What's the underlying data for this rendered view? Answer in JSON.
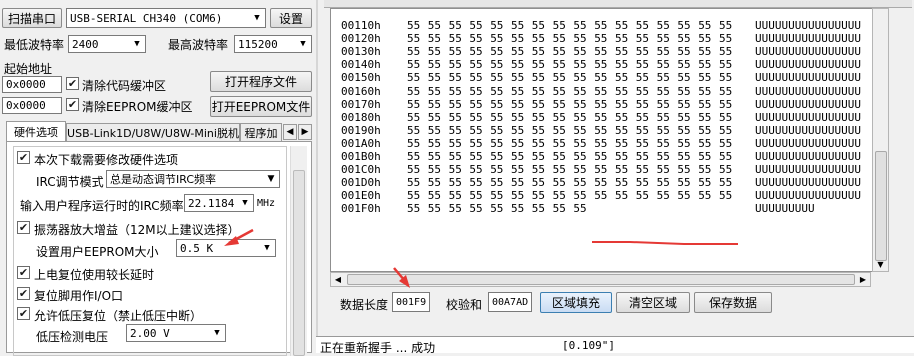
{
  "left": {
    "scan_button": "扫描串口",
    "port_value": "USB-SERIAL CH340 (COM6)",
    "settings_button": "设置",
    "min_baud_label": "最低波特率",
    "min_baud_value": "2400",
    "max_baud_label": "最高波特率",
    "max_baud_value": "115200",
    "start_addr_label": "起始地址",
    "addr1_value": "0x0000",
    "clear_code_label": "清除代码缓冲区",
    "open_prog_button": "打开程序文件",
    "addr2_value": "0x0000",
    "clear_eeprom_label": "清除EEPROM缓冲区",
    "open_eeprom_button": "打开EEPROM文件",
    "tabs": [
      "硬件选项",
      "USB-Link1D/U8W/U8W-Mini脱机",
      "程序加"
    ],
    "options": {
      "modify_hw_label": "本次下载需要修改硬件选项",
      "irc_mode_label": "IRC调节模式",
      "irc_mode_value": "总是动态调节IRC频率",
      "irc_freq_label": "输入用户程序运行时的IRC频率",
      "irc_freq_value": "22.1184",
      "irc_freq_unit": "MHz",
      "osc_gain_label": "振荡器放大增益（12M以上建议选择）",
      "eeprom_size_label": "设置用户EEPROM大小",
      "eeprom_size_value": "0.5 K",
      "power_reset_label": "上电复位使用较长延时",
      "reset_io_label": "复位脚用作I/O口",
      "lvd_reset_label": "允许低压复位（禁止低压中断）",
      "lvd_voltage_label": "低压检测电压",
      "lvd_voltage_value": "2.00 V"
    }
  },
  "hex": {
    "rows": [
      {
        "addr": "00110h",
        "bytes": [
          "55",
          "55",
          "55",
          "55",
          "55",
          "55",
          "55",
          "55",
          "55",
          "55",
          "55",
          "55",
          "55",
          "55",
          "55",
          "55"
        ],
        "ascii": "UUUUUUUUUUUUUUUU"
      },
      {
        "addr": "00120h",
        "bytes": [
          "55",
          "55",
          "55",
          "55",
          "55",
          "55",
          "55",
          "55",
          "55",
          "55",
          "55",
          "55",
          "55",
          "55",
          "55",
          "55"
        ],
        "ascii": "UUUUUUUUUUUUUUUU"
      },
      {
        "addr": "00130h",
        "bytes": [
          "55",
          "55",
          "55",
          "55",
          "55",
          "55",
          "55",
          "55",
          "55",
          "55",
          "55",
          "55",
          "55",
          "55",
          "55",
          "55"
        ],
        "ascii": "UUUUUUUUUUUUUUUU"
      },
      {
        "addr": "00140h",
        "bytes": [
          "55",
          "55",
          "55",
          "55",
          "55",
          "55",
          "55",
          "55",
          "55",
          "55",
          "55",
          "55",
          "55",
          "55",
          "55",
          "55"
        ],
        "ascii": "UUUUUUUUUUUUUUUU"
      },
      {
        "addr": "00150h",
        "bytes": [
          "55",
          "55",
          "55",
          "55",
          "55",
          "55",
          "55",
          "55",
          "55",
          "55",
          "55",
          "55",
          "55",
          "55",
          "55",
          "55"
        ],
        "ascii": "UUUUUUUUUUUUUUUU"
      },
      {
        "addr": "00160h",
        "bytes": [
          "55",
          "55",
          "55",
          "55",
          "55",
          "55",
          "55",
          "55",
          "55",
          "55",
          "55",
          "55",
          "55",
          "55",
          "55",
          "55"
        ],
        "ascii": "UUUUUUUUUUUUUUUU"
      },
      {
        "addr": "00170h",
        "bytes": [
          "55",
          "55",
          "55",
          "55",
          "55",
          "55",
          "55",
          "55",
          "55",
          "55",
          "55",
          "55",
          "55",
          "55",
          "55",
          "55"
        ],
        "ascii": "UUUUUUUUUUUUUUUU"
      },
      {
        "addr": "00180h",
        "bytes": [
          "55",
          "55",
          "55",
          "55",
          "55",
          "55",
          "55",
          "55",
          "55",
          "55",
          "55",
          "55",
          "55",
          "55",
          "55",
          "55"
        ],
        "ascii": "UUUUUUUUUUUUUUUU"
      },
      {
        "addr": "00190h",
        "bytes": [
          "55",
          "55",
          "55",
          "55",
          "55",
          "55",
          "55",
          "55",
          "55",
          "55",
          "55",
          "55",
          "55",
          "55",
          "55",
          "55"
        ],
        "ascii": "UUUUUUUUUUUUUUUU"
      },
      {
        "addr": "001A0h",
        "bytes": [
          "55",
          "55",
          "55",
          "55",
          "55",
          "55",
          "55",
          "55",
          "55",
          "55",
          "55",
          "55",
          "55",
          "55",
          "55",
          "55"
        ],
        "ascii": "UUUUUUUUUUUUUUUU"
      },
      {
        "addr": "001B0h",
        "bytes": [
          "55",
          "55",
          "55",
          "55",
          "55",
          "55",
          "55",
          "55",
          "55",
          "55",
          "55",
          "55",
          "55",
          "55",
          "55",
          "55"
        ],
        "ascii": "UUUUUUUUUUUUUUUU"
      },
      {
        "addr": "001C0h",
        "bytes": [
          "55",
          "55",
          "55",
          "55",
          "55",
          "55",
          "55",
          "55",
          "55",
          "55",
          "55",
          "55",
          "55",
          "55",
          "55",
          "55"
        ],
        "ascii": "UUUUUUUUUUUUUUUU"
      },
      {
        "addr": "001D0h",
        "bytes": [
          "55",
          "55",
          "55",
          "55",
          "55",
          "55",
          "55",
          "55",
          "55",
          "55",
          "55",
          "55",
          "55",
          "55",
          "55",
          "55"
        ],
        "ascii": "UUUUUUUUUUUUUUUU"
      },
      {
        "addr": "001E0h",
        "bytes": [
          "55",
          "55",
          "55",
          "55",
          "55",
          "55",
          "55",
          "55",
          "55",
          "55",
          "55",
          "55",
          "55",
          "55",
          "55",
          "55"
        ],
        "ascii": "UUUUUUUUUUUUUUUU"
      },
      {
        "addr": "001F0h",
        "bytes": [
          "55",
          "55",
          "55",
          "55",
          "55",
          "55",
          "55",
          "55",
          "55",
          "",
          "",
          "",
          "",
          "",
          "",
          ""
        ],
        "ascii": "UUUUUUUUU"
      }
    ]
  },
  "bottom": {
    "data_len_label": "数据长度",
    "data_len_value": "001F9",
    "checksum_label": "校验和",
    "checksum_value": "00A7AD",
    "fill_button": "区域填充",
    "clear_button": "清空区域",
    "save_button": "保存数据"
  },
  "status": {
    "message": "正在重新握手 ... 成功",
    "time": "[0.109\"]"
  },
  "colors": {
    "annotation": "#e53935",
    "selection_blue": "#c9dcf3"
  },
  "icons": [
    "checkmark-icon",
    "dropdown-arrow-icon",
    "red-arrow-annotation",
    "scroll-arrow-icon"
  ]
}
